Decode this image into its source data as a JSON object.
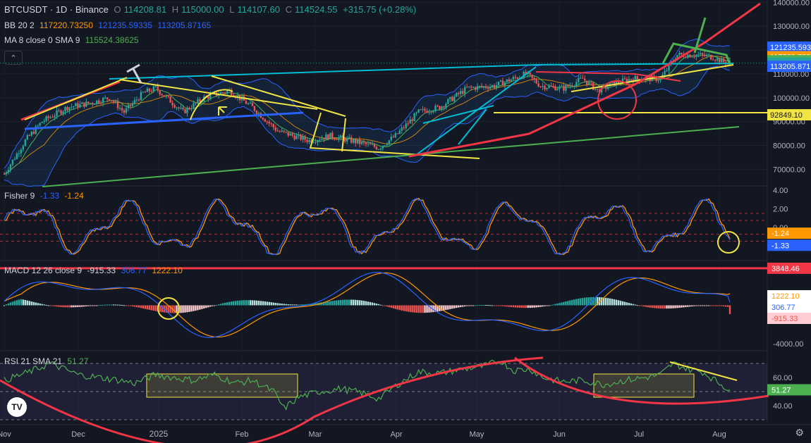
{
  "header": {
    "symbol": "BTCUSDT · 1D · Binance",
    "ohlc": {
      "o_label": "O",
      "o": "114208.81",
      "h_label": "H",
      "h": "115000.00",
      "l_label": "L",
      "l": "114107.60",
      "c_label": "C",
      "c": "114524.55",
      "chg": "+315.75 (+0.28%)"
    },
    "bb": {
      "label": "BB 20 2",
      "upper": "117220.73250",
      "basis": "121235.59335",
      "lower": "113205.87165"
    },
    "ma": {
      "label": "MA 8 close 0 SMA 9",
      "value": "115524.38625"
    }
  },
  "colors": {
    "bg": "#131722",
    "up": "#26a69a",
    "down": "#ef5350",
    "bb": "#2962ff",
    "yellow": "#f0e442",
    "red": "#f23645",
    "green": "#4caf50",
    "cyan": "#00bcd4",
    "orange": "#ff9800",
    "blue": "#2962ff"
  },
  "chart_data": [
    {
      "type": "candlestick",
      "title": "BTCUSDT · 1D · Binance",
      "x_ticks": [
        "Nov",
        "Dec",
        "2025",
        "Feb",
        "Mar",
        "Apr",
        "May",
        "Jun",
        "Jul",
        "Aug"
      ],
      "y_ticks": [
        "140000.00",
        "130000.00",
        "120000.00",
        "110000.00",
        "100000.00",
        "90000.00",
        "80000.00",
        "70000.00"
      ],
      "ylim": [
        63000,
        141000
      ],
      "price_labels": [
        {
          "text": "121235.593",
          "value": 121235.59,
          "color": "#2962ff"
        },
        {
          "text": "117220.732",
          "value": 117220.73,
          "color": "#ff9800"
        },
        {
          "text": "115524.386",
          "value": 115524.39,
          "color": "#4caf50"
        },
        {
          "text": "114524.55",
          "value": 114524.55,
          "color": "#26a69a"
        },
        {
          "text": "113205.871",
          "value": 113205.87,
          "color": "#2962ff"
        },
        {
          "text": "92849.10",
          "value": 92849.1,
          "color": "#f0e442"
        }
      ],
      "close_anchors": [
        [
          0,
          68000
        ],
        [
          10,
          82000
        ],
        [
          18,
          90000
        ],
        [
          30,
          96000
        ],
        [
          42,
          98000
        ],
        [
          50,
          100000
        ],
        [
          57,
          94000
        ],
        [
          66,
          102000
        ],
        [
          72,
          104000
        ],
        [
          85,
          94000
        ],
        [
          95,
          100000
        ],
        [
          107,
          103000
        ],
        [
          118,
          96000
        ],
        [
          130,
          86000
        ],
        [
          145,
          82000
        ],
        [
          155,
          84000
        ],
        [
          165,
          82000
        ],
        [
          178,
          79000
        ],
        [
          186,
          84000
        ],
        [
          197,
          94000
        ],
        [
          207,
          96000
        ],
        [
          220,
          104000
        ],
        [
          233,
          105000
        ],
        [
          248,
          110000
        ],
        [
          255,
          105000
        ],
        [
          266,
          104000
        ],
        [
          275,
          108000
        ],
        [
          282,
          103000
        ],
        [
          290,
          106000
        ],
        [
          298,
          108000
        ],
        [
          312,
          108000
        ],
        [
          320,
          118000
        ],
        [
          330,
          118000
        ],
        [
          337,
          117000
        ],
        [
          342,
          115000
        ],
        [
          345,
          114524
        ]
      ]
    },
    {
      "type": "line",
      "title": "Fisher 9",
      "series": [
        {
          "name": "Fisher",
          "last": "-1.33",
          "color": "#2962ff"
        },
        {
          "name": "Trigger",
          "last": "-1.24",
          "color": "#ff9800"
        }
      ],
      "y_ticks": [
        "4.00",
        "2.00",
        "0.00"
      ],
      "ylim": [
        -3.2,
        4.3
      ],
      "levels": [
        1.5,
        0.75,
        -0.75,
        -1.5
      ],
      "value_labels": [
        {
          "text": "-1.24",
          "value": -1.24,
          "color": "#ff9800"
        },
        {
          "text": "-1.33",
          "value": -1.33,
          "color": "#2962ff"
        }
      ]
    },
    {
      "type": "bar",
      "title": "MACD 12 26 close 9",
      "series": [
        {
          "name": "Histogram",
          "last": "-915.33"
        },
        {
          "name": "MACD",
          "last": "306.77",
          "color": "#2962ff"
        },
        {
          "name": "Signal",
          "last": "1222.10",
          "color": "#ff9800"
        }
      ],
      "y_ticks": [
        "-4000.00"
      ],
      "ylim": [
        -4500,
        4500
      ],
      "level_line": {
        "value": 3848.46,
        "label": "3848.46",
        "color": "#f23645"
      },
      "value_labels": [
        {
          "text": "1222.10",
          "value": 1222.1,
          "color": "#ff9800"
        },
        {
          "text": "306.77",
          "value": 306.77,
          "color": "#2962ff"
        },
        {
          "text": "-915.33",
          "value": -915.33,
          "color": "#ef5350"
        }
      ]
    },
    {
      "type": "line",
      "title": "RSI 21 SMA 21",
      "series": [
        {
          "name": "RSI",
          "last": "51.27",
          "color": "#4caf50"
        }
      ],
      "y_ticks": [
        "60.00",
        "40.00"
      ],
      "ylim": [
        28,
        78
      ],
      "levels": [
        70,
        50,
        30
      ],
      "value_labels": [
        {
          "text": "51.27",
          "value": 51.27,
          "color": "#4caf50"
        }
      ],
      "rsi_anchors": [
        [
          0,
          58
        ],
        [
          12,
          64
        ],
        [
          22,
          70
        ],
        [
          35,
          62
        ],
        [
          45,
          60
        ],
        [
          55,
          58
        ],
        [
          62,
          56
        ],
        [
          72,
          62
        ],
        [
          80,
          60
        ],
        [
          90,
          58
        ],
        [
          100,
          62
        ],
        [
          110,
          56
        ],
        [
          118,
          58
        ],
        [
          128,
          50
        ],
        [
          133,
          38
        ],
        [
          140,
          46
        ],
        [
          150,
          50
        ],
        [
          160,
          52
        ],
        [
          170,
          49
        ],
        [
          178,
          45
        ],
        [
          188,
          56
        ],
        [
          197,
          64
        ],
        [
          207,
          63
        ],
        [
          218,
          66
        ],
        [
          228,
          68
        ],
        [
          236,
          72
        ],
        [
          242,
          65
        ],
        [
          250,
          66
        ],
        [
          256,
          60
        ],
        [
          265,
          57
        ],
        [
          275,
          58
        ],
        [
          285,
          55
        ],
        [
          295,
          58
        ],
        [
          305,
          60
        ],
        [
          312,
          62
        ],
        [
          318,
          70
        ],
        [
          325,
          66
        ],
        [
          332,
          64
        ],
        [
          340,
          56
        ],
        [
          345,
          51
        ]
      ]
    }
  ],
  "ui": {
    "collapse_glyph": "⌃",
    "logo": "TV",
    "gear_glyph": "⚙"
  }
}
